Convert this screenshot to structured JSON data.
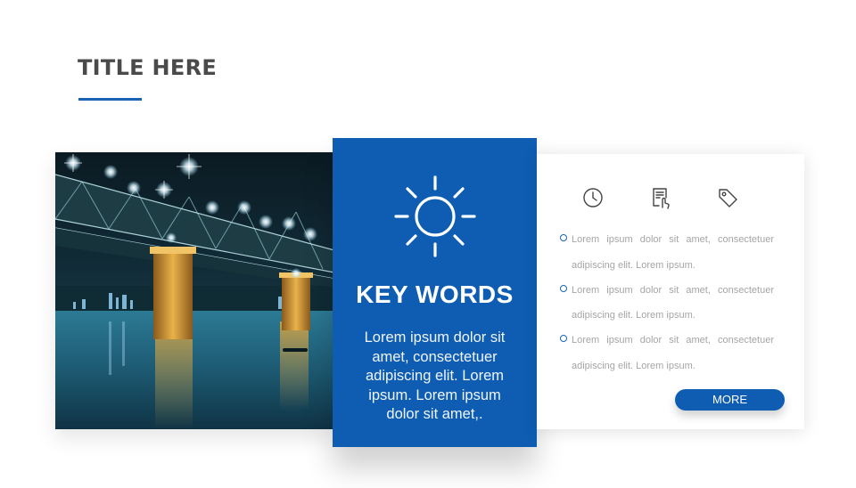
{
  "header": {
    "title": "TITLE HERE",
    "accent_color": "#1a63b4"
  },
  "photo": {
    "subject": "night view of an illuminated bridge over a river"
  },
  "keycard": {
    "icon": "sun-icon",
    "title": "KEY WORDS",
    "text": "Lorem ipsum dolor sit amet, consectetuer adipiscing elit. Lorem ipsum. Lorem ipsum dolor sit amet,.",
    "background_color": "#0e5db3"
  },
  "rightcard": {
    "icons": [
      "clock-icon",
      "document-touch-icon",
      "tag-icon"
    ],
    "bullets": [
      {
        "line1": "Lorem ipsum dolor sit amet, consectetuer",
        "line2": "adipiscing elit. Lorem ipsum."
      },
      {
        "line1": "Lorem ipsum dolor sit amet, consectetuer",
        "line2": "adipiscing elit. Lorem ipsum."
      },
      {
        "line1": "Lorem ipsum dolor sit amet, consectetuer",
        "line2": "adipiscing elit. Lorem ipsum."
      }
    ],
    "more_label": "MORE"
  }
}
